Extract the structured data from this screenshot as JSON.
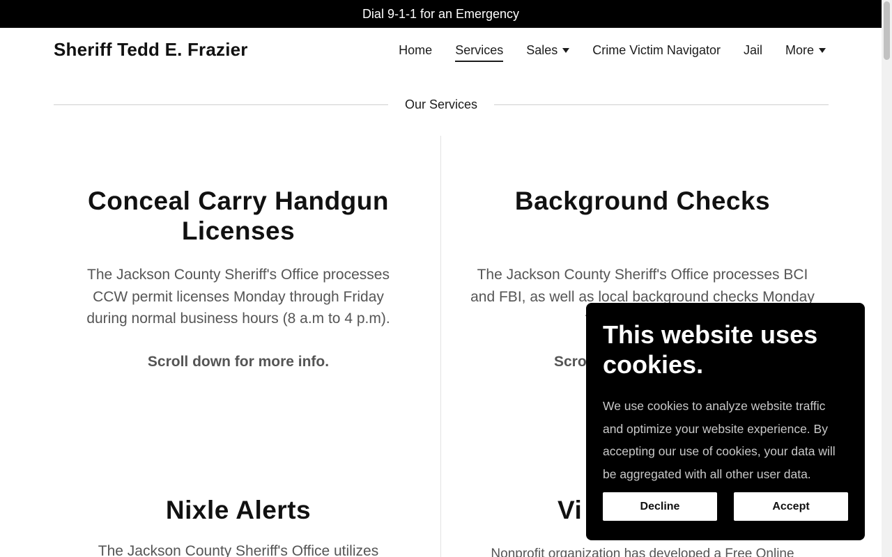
{
  "announcement": "Dial 9-1-1 for an Emergency",
  "brand": "Sheriff Tedd E. Frazier",
  "nav": [
    {
      "label": "Home",
      "active": false,
      "dropdown": false
    },
    {
      "label": "Services",
      "active": true,
      "dropdown": false
    },
    {
      "label": "Sales",
      "active": false,
      "dropdown": true
    },
    {
      "label": "Crime Victim Navigator",
      "active": false,
      "dropdown": false
    },
    {
      "label": "Jail",
      "active": false,
      "dropdown": false
    },
    {
      "label": "More",
      "active": false,
      "dropdown": true
    }
  ],
  "section_title": "Our Services",
  "services": {
    "ccw": {
      "title": "Conceal Carry Handgun Licenses",
      "body": "The Jackson County Sheriff's Office processes CCW permit licenses Monday through Friday during normal business hours (8 a.m to 4 p.m).",
      "more": "Scroll down for more info."
    },
    "background": {
      "title": "Background Checks",
      "body": "The Jackson County Sheriff's Office processes BCI and FBI, as well as local background checks Monday through Friday du",
      "more": "Scro"
    },
    "nixle": {
      "title": "Nixle Alerts",
      "body": "The Jackson County Sheriff's Office utilizes"
    },
    "vine": {
      "title": "Vi",
      "body": "Nonprofit organization has developed a Free Online"
    }
  },
  "cookie": {
    "title": "This website uses cookies.",
    "body": "We use cookies to analyze website traffic and optimize your website experience. By accepting our use of cookies, your data will be aggregated with all other user data.",
    "decline": "Decline",
    "accept": "Accept"
  }
}
